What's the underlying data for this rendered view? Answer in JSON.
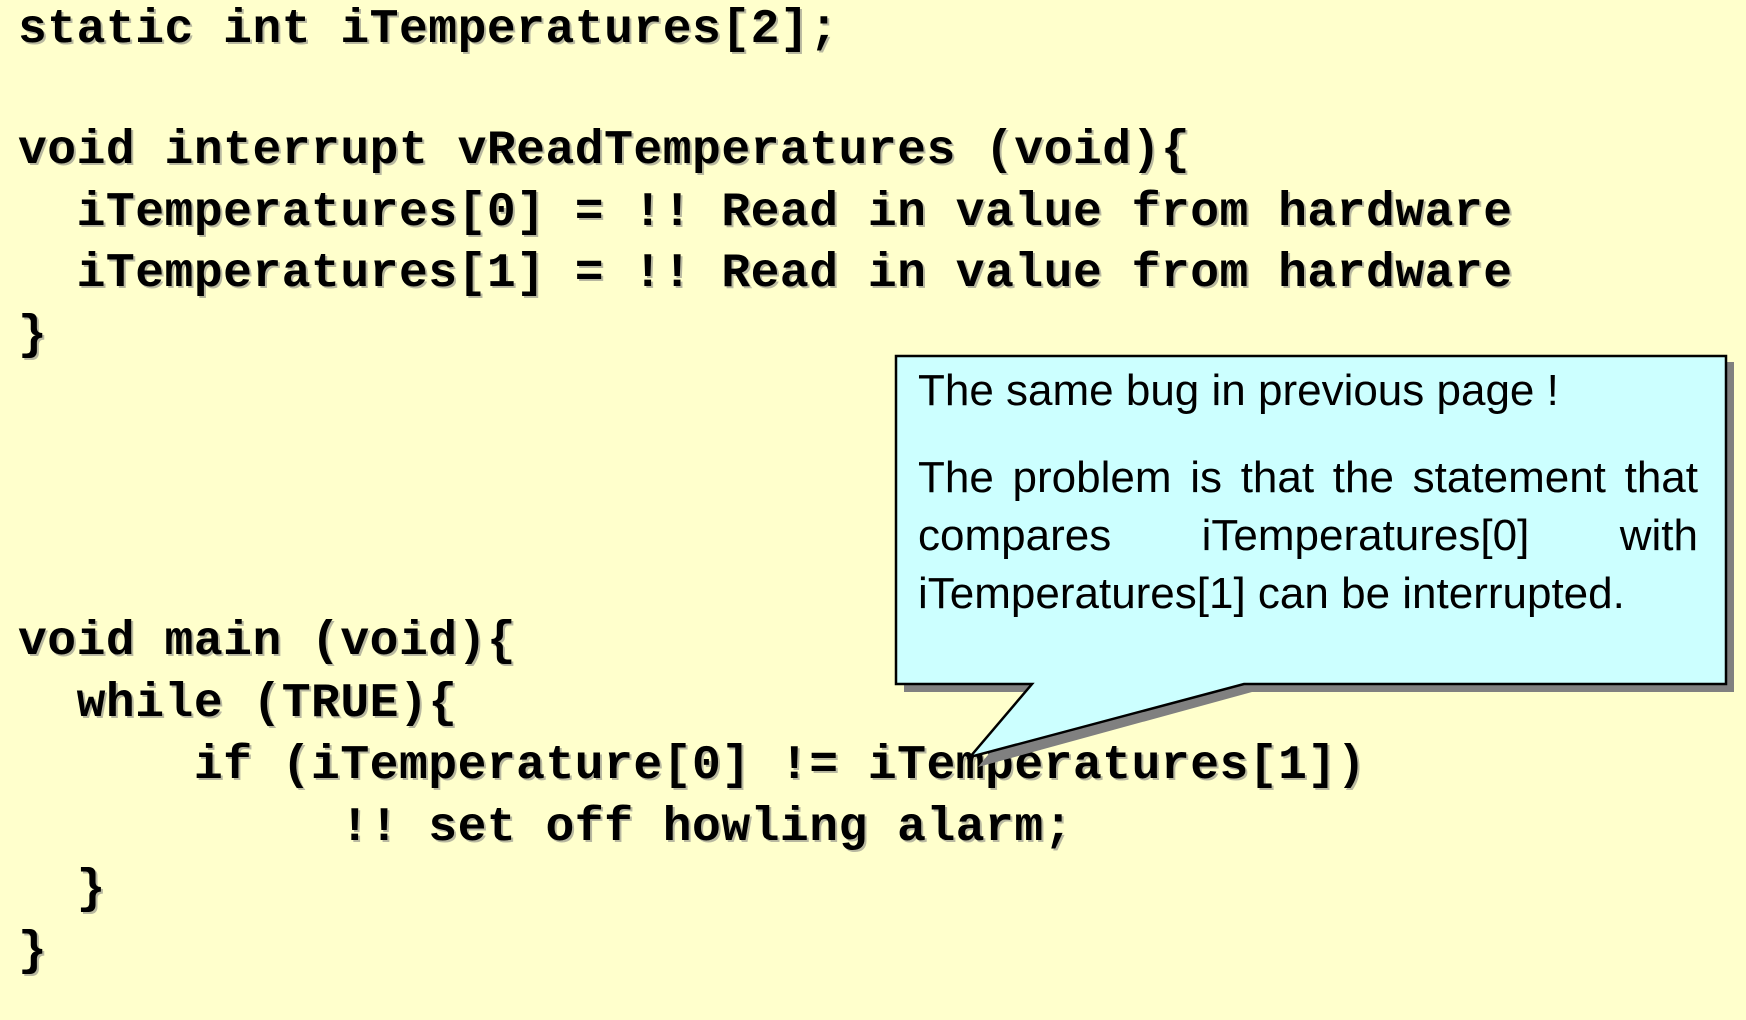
{
  "code_lines": [
    "static int iTemperatures[2];",
    "",
    "void interrupt vReadTemperatures (void){",
    "  iTemperatures[0] = !! Read in value from hardware",
    "  iTemperatures[1] = !! Read in value from hardware",
    "}",
    "",
    "",
    "",
    "void main (void){",
    "  while (TRUE){",
    "      if (iTemperature[0] != iTemperatures[1])",
    "           !! set off howling alarm;",
    "  }",
    "}"
  ],
  "callout": {
    "title": "The same bug in previous page !",
    "body": "The problem is that the statement that compares iTemperatures[0] with iTemperatures[1] can be interrupted.",
    "fill_color": "#ccffff",
    "border_color": "#000000",
    "shadow_color": "#808080"
  },
  "colors": {
    "background": "#ffffcc",
    "text": "#000000"
  }
}
